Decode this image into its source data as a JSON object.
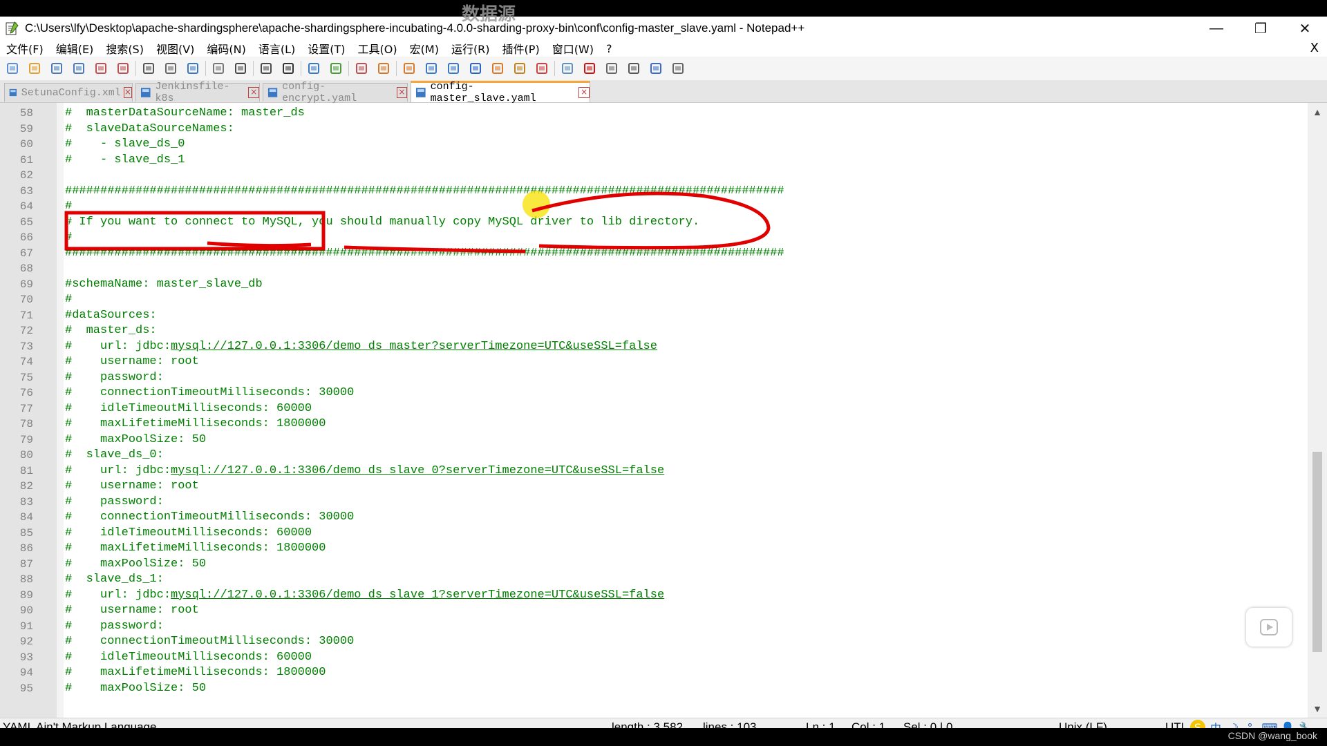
{
  "window": {
    "title": "C:\\Users\\lfy\\Desktop\\apache-shardingsphere\\apache-shardingsphere-incubating-4.0.0-sharding-proxy-bin\\conf\\config-master_slave.yaml - Notepad++",
    "minimize": "—",
    "restore": "❐",
    "close": "✕"
  },
  "watermark_top": "数据源",
  "menu": {
    "items": [
      "文件(F)",
      "编辑(E)",
      "搜索(S)",
      "视图(V)",
      "编码(N)",
      "语言(L)",
      "设置(T)",
      "工具(O)",
      "宏(M)",
      "运行(R)",
      "插件(P)",
      "窗口(W)",
      "?"
    ],
    "close": "X"
  },
  "toolbar": {
    "icons": [
      "new-file-icon",
      "open-file-icon",
      "save-icon",
      "save-all-icon",
      "close-icon",
      "close-all-icon",
      "print-icon",
      "cut-icon",
      "copy-icon",
      "paste-icon",
      "undo-icon",
      "redo-icon",
      "find-icon",
      "replace-icon",
      "zoom-in-icon",
      "zoom-out-icon",
      "sync-vertical-icon",
      "sync-horizontal-icon",
      "word-wrap-icon",
      "show-all-chars-icon",
      "indent-guide-icon",
      "doc-map-icon",
      "function-list-icon",
      "folder-workspace-icon",
      "monitoring-icon",
      "record-macro-icon",
      "stop-macro-icon",
      "play-macro-icon",
      "run-macro-multiple-icon",
      "save-macro-icon"
    ]
  },
  "tabs": [
    {
      "label": "SetunaConfig.xml",
      "active": false
    },
    {
      "label": "Jenkinsfile-k8s",
      "active": false
    },
    {
      "label": "config-encrypt.yaml",
      "active": false
    },
    {
      "label": "config-master_slave.yaml",
      "active": true
    }
  ],
  "editor": {
    "lines": [
      {
        "n": "58",
        "pre": "#  masterDataSourceName: master_ds",
        "link": "",
        "post": ""
      },
      {
        "n": "59",
        "pre": "#  slaveDataSourceNames:",
        "link": "",
        "post": ""
      },
      {
        "n": "60",
        "pre": "#    - slave_ds_0",
        "link": "",
        "post": ""
      },
      {
        "n": "61",
        "pre": "#    - slave_ds_1",
        "link": "",
        "post": ""
      },
      {
        "n": "62",
        "pre": "",
        "link": "",
        "post": ""
      },
      {
        "n": "63",
        "pre": "######################################################################################################",
        "link": "",
        "post": ""
      },
      {
        "n": "64",
        "pre": "#",
        "link": "",
        "post": ""
      },
      {
        "n": "65",
        "pre": "# If you want to connect to MySQL, you should manually copy MySQL driver to lib directory.",
        "link": "",
        "post": ""
      },
      {
        "n": "66",
        "pre": "#",
        "link": "",
        "post": ""
      },
      {
        "n": "67",
        "pre": "######################################################################################################",
        "link": "",
        "post": ""
      },
      {
        "n": "68",
        "pre": "",
        "link": "",
        "post": ""
      },
      {
        "n": "69",
        "pre": "#schemaName: master_slave_db",
        "link": "",
        "post": ""
      },
      {
        "n": "70",
        "pre": "#",
        "link": "",
        "post": ""
      },
      {
        "n": "71",
        "pre": "#dataSources:",
        "link": "",
        "post": ""
      },
      {
        "n": "72",
        "pre": "#  master_ds:",
        "link": "",
        "post": ""
      },
      {
        "n": "73",
        "pre": "#    url: jdbc:",
        "link": "mysql://127.0.0.1:3306/demo_ds_master?serverTimezone=UTC&useSSL=false",
        "post": ""
      },
      {
        "n": "74",
        "pre": "#    username: root",
        "link": "",
        "post": ""
      },
      {
        "n": "75",
        "pre": "#    password:",
        "link": "",
        "post": ""
      },
      {
        "n": "76",
        "pre": "#    connectionTimeoutMilliseconds: 30000",
        "link": "",
        "post": ""
      },
      {
        "n": "77",
        "pre": "#    idleTimeoutMilliseconds: 60000",
        "link": "",
        "post": ""
      },
      {
        "n": "78",
        "pre": "#    maxLifetimeMilliseconds: 1800000",
        "link": "",
        "post": ""
      },
      {
        "n": "79",
        "pre": "#    maxPoolSize: 50",
        "link": "",
        "post": ""
      },
      {
        "n": "80",
        "pre": "#  slave_ds_0:",
        "link": "",
        "post": ""
      },
      {
        "n": "81",
        "pre": "#    url: jdbc:",
        "link": "mysql://127.0.0.1:3306/demo_ds_slave_0?serverTimezone=UTC&useSSL=false",
        "post": ""
      },
      {
        "n": "82",
        "pre": "#    username: root",
        "link": "",
        "post": ""
      },
      {
        "n": "83",
        "pre": "#    password:",
        "link": "",
        "post": ""
      },
      {
        "n": "84",
        "pre": "#    connectionTimeoutMilliseconds: 30000",
        "link": "",
        "post": ""
      },
      {
        "n": "85",
        "pre": "#    idleTimeoutMilliseconds: 60000",
        "link": "",
        "post": ""
      },
      {
        "n": "86",
        "pre": "#    maxLifetimeMilliseconds: 1800000",
        "link": "",
        "post": ""
      },
      {
        "n": "87",
        "pre": "#    maxPoolSize: 50",
        "link": "",
        "post": ""
      },
      {
        "n": "88",
        "pre": "#  slave_ds_1:",
        "link": "",
        "post": ""
      },
      {
        "n": "89",
        "pre": "#    url: jdbc:",
        "link": "mysql://127.0.0.1:3306/demo_ds_slave_1?serverTimezone=UTC&useSSL=false",
        "post": ""
      },
      {
        "n": "90",
        "pre": "#    username: root",
        "link": "",
        "post": ""
      },
      {
        "n": "91",
        "pre": "#    password:",
        "link": "",
        "post": ""
      },
      {
        "n": "92",
        "pre": "#    connectionTimeoutMilliseconds: 30000",
        "link": "",
        "post": ""
      },
      {
        "n": "93",
        "pre": "#    idleTimeoutMilliseconds: 60000",
        "link": "",
        "post": ""
      },
      {
        "n": "94",
        "pre": "#    maxLifetimeMilliseconds: 1800000",
        "link": "",
        "post": ""
      },
      {
        "n": "95",
        "pre": "#    maxPoolSize: 50",
        "link": "",
        "post": ""
      }
    ]
  },
  "status": {
    "language": "YAML Ain't Markup Language",
    "length": "length : 3,582",
    "lines": "lines : 103",
    "ln": "Ln : 1",
    "col": "Col : 1",
    "sel": "Sel : 0 | 0",
    "eol": "Unix (LF)",
    "encoding": "UTI",
    "ime_chars": [
      "中",
      "☽",
      "°,",
      "⌨",
      "👤",
      "🔧"
    ]
  },
  "watermark_bottom": "CSDN @wang_book",
  "colors": {
    "comment": "#008000",
    "annotation": "#e00000",
    "highlight": "#f5e000",
    "active_tab_accent": "#f7a63c"
  }
}
